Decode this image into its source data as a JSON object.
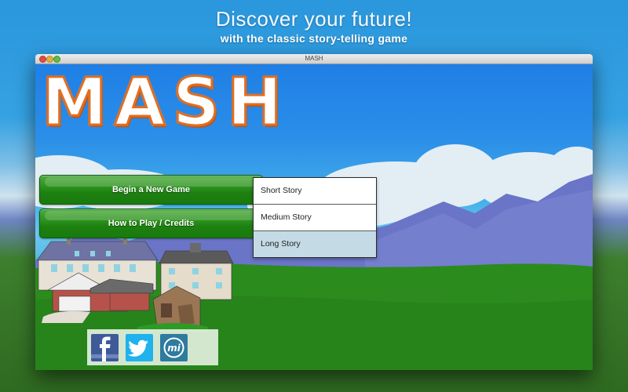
{
  "promo": {
    "headline": "Discover your future!",
    "subheadline": "with the classic story-telling game"
  },
  "window": {
    "title": "MASH"
  },
  "app": {
    "logo_text": "MASH",
    "buttons": {
      "new_game": "Begin a New Game",
      "how_to_play": "How to Play / Credits"
    },
    "story_length_menu": {
      "options": [
        "Short Story",
        "Medium Story",
        "Long Story"
      ],
      "selected": "Long Story"
    },
    "social": [
      {
        "name": "facebook",
        "glyph": "f"
      },
      {
        "name": "twitter",
        "glyph": "bird"
      },
      {
        "name": "developer",
        "glyph": "mi"
      }
    ]
  },
  "colors": {
    "button_green": "#1e8011",
    "logo_outline": "#e36d1e",
    "selected_option": "#c4dbe6",
    "facebook": "#3e5a99",
    "twitter": "#1fb2ec",
    "developer": "#2e7b9f"
  }
}
